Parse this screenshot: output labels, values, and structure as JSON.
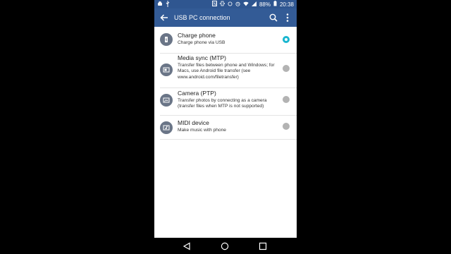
{
  "status_bar": {
    "left_icons": [
      "android-debug-icon",
      "usb-icon"
    ],
    "right_icons": [
      "nfc-icon",
      "vibrate-icon",
      "sync-icon",
      "alarm-icon",
      "wifi-icon",
      "signal-icon",
      "battery-icon"
    ],
    "battery": "88%",
    "time": "20:38"
  },
  "app_bar": {
    "title": "USB PC connection"
  },
  "options": [
    {
      "title": "Charge phone",
      "desc": "Charge phone via USB",
      "icon": "phone-charge-icon",
      "selected": true
    },
    {
      "title": "Media sync (MTP)",
      "desc": "Transfer files between phone and Windows; for Macs, use Android file transfer (see www.android.com/filetransfer)",
      "icon": "media-sync-icon",
      "selected": false
    },
    {
      "title": "Camera (PTP)",
      "desc": "Transfer photos by connecting as a camera (transfer files when MTP is not supported)",
      "icon": "camera-icon",
      "selected": false
    },
    {
      "title": "MIDI device",
      "desc": "Make music with phone",
      "icon": "midi-icon",
      "selected": false
    }
  ],
  "colors": {
    "app_bar": "#335b96",
    "accent": "#19b6cf"
  }
}
